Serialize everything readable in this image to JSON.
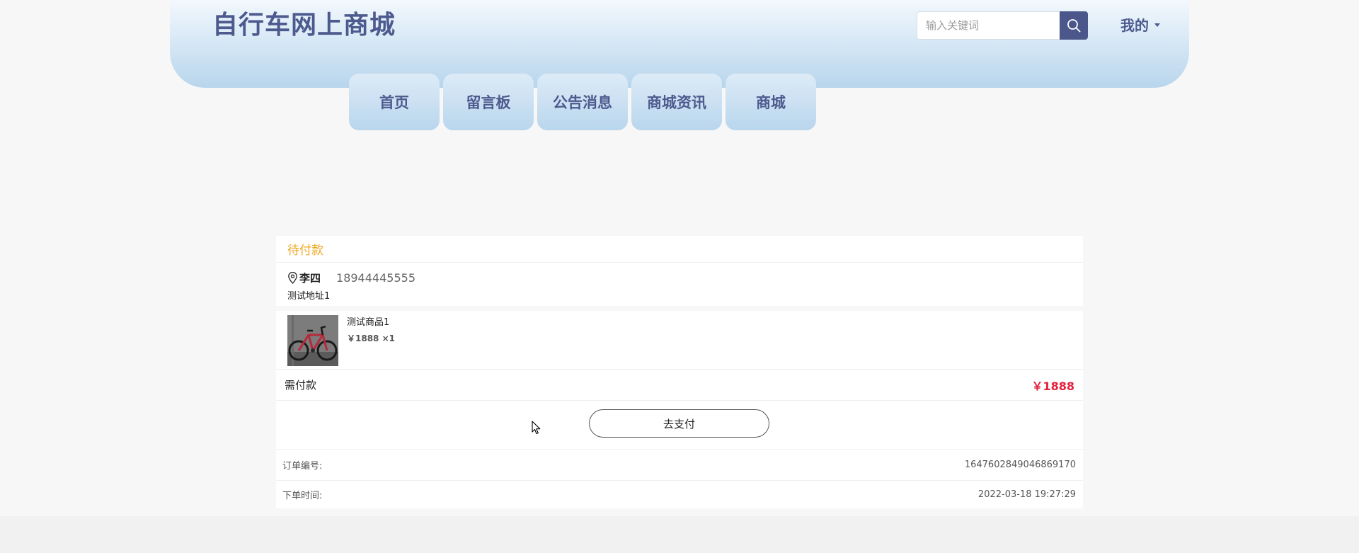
{
  "header": {
    "site_title": "自行车网上商城",
    "search_placeholder": "输入关键词",
    "search_value": "",
    "search_icon": "search-icon",
    "user_menu_label": "我的",
    "user_menu_icon": "caret-down-icon"
  },
  "nav": {
    "items": [
      {
        "label": "首页"
      },
      {
        "label": "留言板"
      },
      {
        "label": "公告消息"
      },
      {
        "label": "商城资讯"
      },
      {
        "label": "商城"
      }
    ]
  },
  "order": {
    "status": "待付款",
    "receiver": {
      "icon": "location-pin-icon",
      "name": "李四",
      "phone": "18944445555",
      "address": "测试地址1"
    },
    "product": {
      "name": "测试商品1",
      "price_qty": "￥1888 ×1",
      "image": "bicycle-image"
    },
    "due_label": "需付款",
    "due_amount": "￥1888",
    "pay_button_label": "去支付",
    "order_no_label": "订单编号:",
    "order_no": "1647602849046869170",
    "order_time_label": "下单时间:",
    "order_time": "2022-03-18 19:27:29"
  },
  "colors": {
    "brand": "#4d5a8e",
    "status_pending": "#f0a824",
    "price_red": "#e3213d",
    "header_gradient_bottom": "#b8d5ec"
  }
}
